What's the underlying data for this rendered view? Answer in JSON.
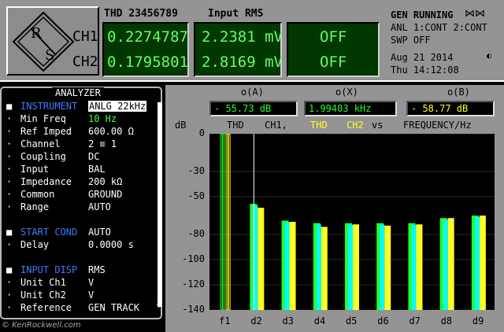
{
  "header": {
    "thd_label": "THD 23456789",
    "rms_label": "Input RMS",
    "ch1_label": "CH1",
    "ch2_label": "CH2",
    "ch1_thd": "0.2274787 %",
    "ch2_thd": "0.1795801 %",
    "ch1_rms": "2.2381 mV",
    "ch2_rms": "2.8169 mV",
    "ch1_aux": "OFF",
    "ch2_aux": "OFF",
    "status_line1": "GEN RUNNING",
    "status_line2": "ANL 1:CONT 2:CONT",
    "status_line3": "SWP OFF",
    "date": "Aug 21 2014",
    "time": "Thu  14:12:08",
    "logo_text": "R/S"
  },
  "analyzer": {
    "title": "ANALYZER",
    "rows": [
      {
        "mk": "■",
        "label": "INSTRUMENT",
        "value": "ANLG  22kHz",
        "head": true,
        "style": "inv"
      },
      {
        "mk": "·",
        "label": "Min Freq",
        "value": "10 Hz",
        "style": "hl"
      },
      {
        "mk": "·",
        "label": "Ref Imped",
        "value": "600.00 Ω"
      },
      {
        "mk": "·",
        "label": "Channel",
        "value": "2 ≡ 1"
      },
      {
        "mk": "·",
        "label": "Coupling",
        "value": "DC"
      },
      {
        "mk": "·",
        "label": "Input",
        "value": "BAL"
      },
      {
        "mk": "·",
        "label": "Impedance",
        "value": "200 kΩ"
      },
      {
        "mk": "·",
        "label": "Common",
        "value": "GROUND"
      },
      {
        "mk": "·",
        "label": "Range",
        "value": "AUTO"
      },
      {
        "mk": "■",
        "label": "START COND",
        "value": "AUTO",
        "head": true
      },
      {
        "mk": "·",
        "label": "Delay",
        "value": "0.0000 s"
      },
      {
        "mk": "■",
        "label": "INPUT DISP",
        "value": "RMS",
        "head": true
      },
      {
        "mk": "·",
        "label": "Unit Ch1",
        "value": "V"
      },
      {
        "mk": "·",
        "label": "Unit Ch2",
        "value": "V"
      },
      {
        "mk": "·",
        "label": "Reference",
        "value": "GEN TRACK"
      }
    ]
  },
  "graph": {
    "o_a_label": "o(A)",
    "o_x_label": "o(X)",
    "o_b_label": "o(B)",
    "o_a_value": "- 55.73 dB",
    "o_x_value": "1.99403 kHz",
    "o_b_value": "- 58.77 dB",
    "y_unit": "dB",
    "title_thd": "THD",
    "title_ch1": "CH1,",
    "title_ch2_a": "THD",
    "title_ch2_b": "CH2",
    "title_vs": "vs",
    "title_x": "FREQUENCY/Hz",
    "copyright": "© KenRockwell.com",
    "colors": {
      "ch1": "#22ff22",
      "ch2": "#ffff22",
      "cyan": "#00ffff"
    }
  },
  "chart_data": {
    "type": "bar",
    "categories": [
      "f1",
      "d2",
      "d3",
      "d4",
      "d5",
      "d6",
      "d7",
      "d8",
      "d9"
    ],
    "ylabel": "dB",
    "ylim": [
      -140,
      0
    ],
    "yticks": [
      0,
      -30,
      -50,
      -80,
      -100,
      -120,
      -140
    ],
    "series": [
      {
        "name": "CH1",
        "values": [
          0,
          -55.73,
          -69,
          -71,
          -71,
          -71,
          -71,
          -67,
          -65
        ]
      },
      {
        "name": "CH2",
        "values": [
          0,
          -58.77,
          -70,
          -74,
          -72,
          -73,
          -72,
          -67,
          -65
        ]
      }
    ],
    "grid": true
  }
}
